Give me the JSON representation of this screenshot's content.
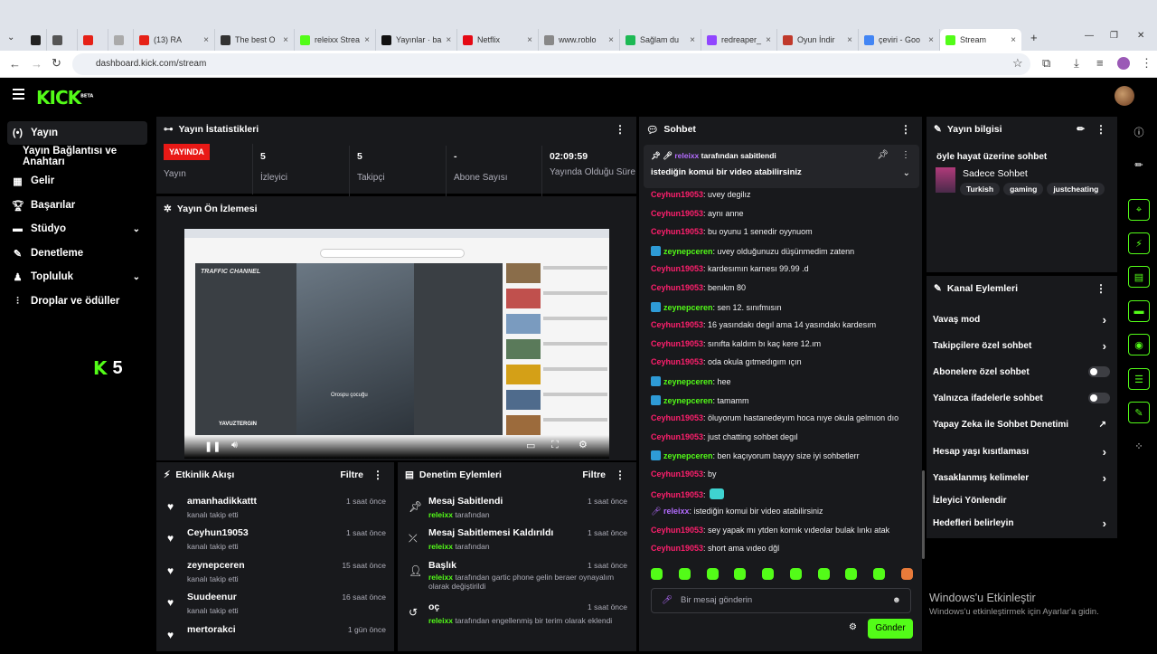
{
  "browser": {
    "tabs": [
      {
        "label": "",
        "color": "#222"
      },
      {
        "label": "",
        "color": "#555"
      },
      {
        "label": "",
        "color": "#e62117"
      },
      {
        "label": "",
        "color": "#aaa"
      },
      {
        "label": "(13) RA",
        "color": "#e62117"
      },
      {
        "label": "The best O",
        "color": "#333"
      },
      {
        "label": "releixx Strea",
        "color": "#53fc18"
      },
      {
        "label": "Yayınlar · ba",
        "color": "#111"
      },
      {
        "label": "Netflix",
        "color": "#e50914"
      },
      {
        "label": "www.roblo",
        "color": "#888"
      },
      {
        "label": "Sağlam du",
        "color": "#1db954"
      },
      {
        "label": "redreaper_",
        "color": "#9146ff"
      },
      {
        "label": "Oyun İndir",
        "color": "#c0392b"
      },
      {
        "label": "çeviri - Goo",
        "color": "#4285f4"
      },
      {
        "label": "Stream",
        "color": "#53fc18"
      }
    ],
    "url": "dashboard.kick.com/stream"
  },
  "app": {
    "logo": "KICK",
    "logo_badge": "BETA"
  },
  "sidebar": {
    "items": [
      {
        "label": "Yayın",
        "icon": "broadcast-icon"
      },
      {
        "label": "Yayın Bağlantısı ve Anahtarı",
        "icon": ""
      },
      {
        "label": "Gelir",
        "icon": "revenue-icon"
      },
      {
        "label": "Başarılar",
        "icon": "trophy-icon"
      },
      {
        "label": "Stüdyo",
        "icon": "studio-icon"
      },
      {
        "label": "Denetleme",
        "icon": "wrench-icon"
      },
      {
        "label": "Topluluk",
        "icon": "community-icon"
      },
      {
        "label": "Droplar ve ödüller",
        "icon": "drops-icon"
      }
    ],
    "viewer_count": "5"
  },
  "stats": {
    "title": "Yayın İstatistikleri",
    "live_badge": "YAYINDA",
    "items": [
      {
        "value": "",
        "label": "Yayın"
      },
      {
        "value": "5",
        "label": "İzleyici"
      },
      {
        "value": "5",
        "label": "Takipçi"
      },
      {
        "value": "-",
        "label": "Abone Sayısı"
      },
      {
        "value": "02:09:59",
        "label": "Yayında Olduğu Süre"
      }
    ]
  },
  "preview": {
    "title": "Yayın Ön İzlemesi",
    "video_channel": "TRAFFIC CHANNEL",
    "video_caption": "Orospu çocuğu",
    "video_watermark": "YAVUZTERGIN"
  },
  "activity": {
    "title": "Etkinlik Akışı",
    "filter": "Filtre",
    "items": [
      {
        "name": "amanhadikkattt",
        "desc": "kanalı takip etti",
        "time": "1 saat önce"
      },
      {
        "name": "Ceyhun19053",
        "desc": "kanalı takip etti",
        "time": "1 saat önce"
      },
      {
        "name": "zeynepceren",
        "desc": "kanalı takip etti",
        "time": "15 saat önce"
      },
      {
        "name": "Suudeenur",
        "desc": "kanalı takip etti",
        "time": "16 saat önce"
      },
      {
        "name": "mertorakci",
        "desc": "",
        "time": "1 gün önce"
      }
    ]
  },
  "moderation": {
    "title": "Denetim Eylemleri",
    "filter": "Filtre",
    "items": [
      {
        "title": "Mesaj Sabitlendi",
        "user": "releixx",
        "desc": "tarafından",
        "time": "1 saat önce"
      },
      {
        "title": "Mesaj Sabitlemesi Kaldırıldı",
        "user": "releixx",
        "desc": "tarafından",
        "time": "1 saat önce"
      },
      {
        "title": "Başlık",
        "user": "releixx",
        "desc": "tarafından gartic phone gelin beraer oynayalım olarak değiştirildi",
        "time": "1 saat önce"
      },
      {
        "title": "oç",
        "user": "releixx",
        "desc": "tarafından engellenmiş bir terim olarak eklendi",
        "time": "1 saat önce"
      }
    ]
  },
  "chat": {
    "title": "Sohbet",
    "pinned_by": "releixx",
    "pinned_by_suffix": "tarafından sabitlendi",
    "pinned_text": "istediğin komui bir video atabilirsiniz",
    "messages": [
      {
        "user": "Ceyhun19053",
        "text": ": uvey degilız",
        "color": "#ff1f6d",
        "badge": false
      },
      {
        "user": "Ceyhun19053",
        "text": ": aynı anne",
        "color": "#ff1f6d",
        "badge": false
      },
      {
        "user": "Ceyhun19053",
        "text": ": bu oyunu 1 senedir oyynuom",
        "color": "#ff1f6d",
        "badge": false
      },
      {
        "user": "zeynepceren",
        "text": ": uvey olduğunuzu düşünmedim zatenn",
        "color": "#53fc18",
        "badge": true
      },
      {
        "user": "Ceyhun19053",
        "text": ": kardesımın karnesı 99.99 .d",
        "color": "#ff1f6d",
        "badge": false
      },
      {
        "user": "Ceyhun19053",
        "text": ": benıkm 80",
        "color": "#ff1f6d",
        "badge": false
      },
      {
        "user": "zeynepceren",
        "text": ": sen 12. sınıfmısın",
        "color": "#53fc18",
        "badge": true
      },
      {
        "user": "Ceyhun19053",
        "text": ": 16 yasındakı degıl ama 14 yasındakı kardesım",
        "color": "#ff1f6d",
        "badge": false
      },
      {
        "user": "Ceyhun19053",
        "text": ": sınıfta kaldım bı kaç kere 12.ım",
        "color": "#ff1f6d",
        "badge": false
      },
      {
        "user": "Ceyhun19053",
        "text": ": oda okula gıtmedıgım ıçın",
        "color": "#ff1f6d",
        "badge": false
      },
      {
        "user": "zeynepceren",
        "text": ": hee",
        "color": "#53fc18",
        "badge": true
      },
      {
        "user": "zeynepceren",
        "text": ": tamamm",
        "color": "#53fc18",
        "badge": true
      },
      {
        "user": "Ceyhun19053",
        "text": ": öluyorum hastanedeyım hoca nıye okula gelmıon dıo",
        "color": "#ff1f6d",
        "badge": false
      },
      {
        "user": "Ceyhun19053",
        "text": ": just chatting sohbet degıl",
        "color": "#ff1f6d",
        "badge": false
      },
      {
        "user": "zeynepceren",
        "text": ": ben kaçıyorum bayyy size iyi sohbetlerr",
        "color": "#53fc18",
        "badge": true
      },
      {
        "user": "Ceyhun19053",
        "text": ": by",
        "color": "#ff1f6d",
        "badge": false
      },
      {
        "user": "Ceyhun19053",
        "text": ":",
        "color": "#ff1f6d",
        "badge": false
      },
      {
        "user": "releixx",
        "text": ": istediğin komui bir video atabilirsiniz",
        "color": "#b46cff",
        "badge": false
      },
      {
        "user": "Ceyhun19053",
        "text": ": sey yapak mı ytden komık vıdeolar bulak lınkı atak",
        "color": "#ff1f6d",
        "badge": false
      },
      {
        "user": "Ceyhun19053",
        "text": ": short ama vıdeo dğl",
        "color": "#ff1f6d",
        "badge": false
      }
    ],
    "placeholder": "Bir mesaj gönderin",
    "send": "Gönder"
  },
  "stream_info": {
    "title": "Yayın bilgisi",
    "stream_title": "öyle hayat üzerine sohbet",
    "category": "Sadece Sohbet",
    "tags": [
      "Turkish",
      "gaming",
      "justcheating"
    ]
  },
  "channel_actions": {
    "title": "Kanal Eylemleri",
    "items": [
      {
        "label": "Vavaş mod",
        "control": "chevron"
      },
      {
        "label": "Takipçilere özel sohbet",
        "control": "chevron"
      },
      {
        "label": "Abonelere özel sohbet",
        "control": "toggle"
      },
      {
        "label": "Yalnızca ifadelerle sohbet",
        "control": "toggle"
      },
      {
        "label": "Yapay Zeka ile Sohbet Denetimi",
        "control": "external"
      },
      {
        "label": "Hesap yaşı kısıtlaması",
        "control": "chevron"
      },
      {
        "label": "Yasaklanmış kelimeler",
        "control": "chevron"
      },
      {
        "label": "İzleyici Yönlendir",
        "control": "none"
      },
      {
        "label": "Hedefleri belirleyin",
        "control": "chevron"
      }
    ]
  },
  "windows": {
    "title": "Windows'u Etkinleştir",
    "subtitle": "Windows'u etkinleştirmek için Ayarlar'a gidin."
  }
}
